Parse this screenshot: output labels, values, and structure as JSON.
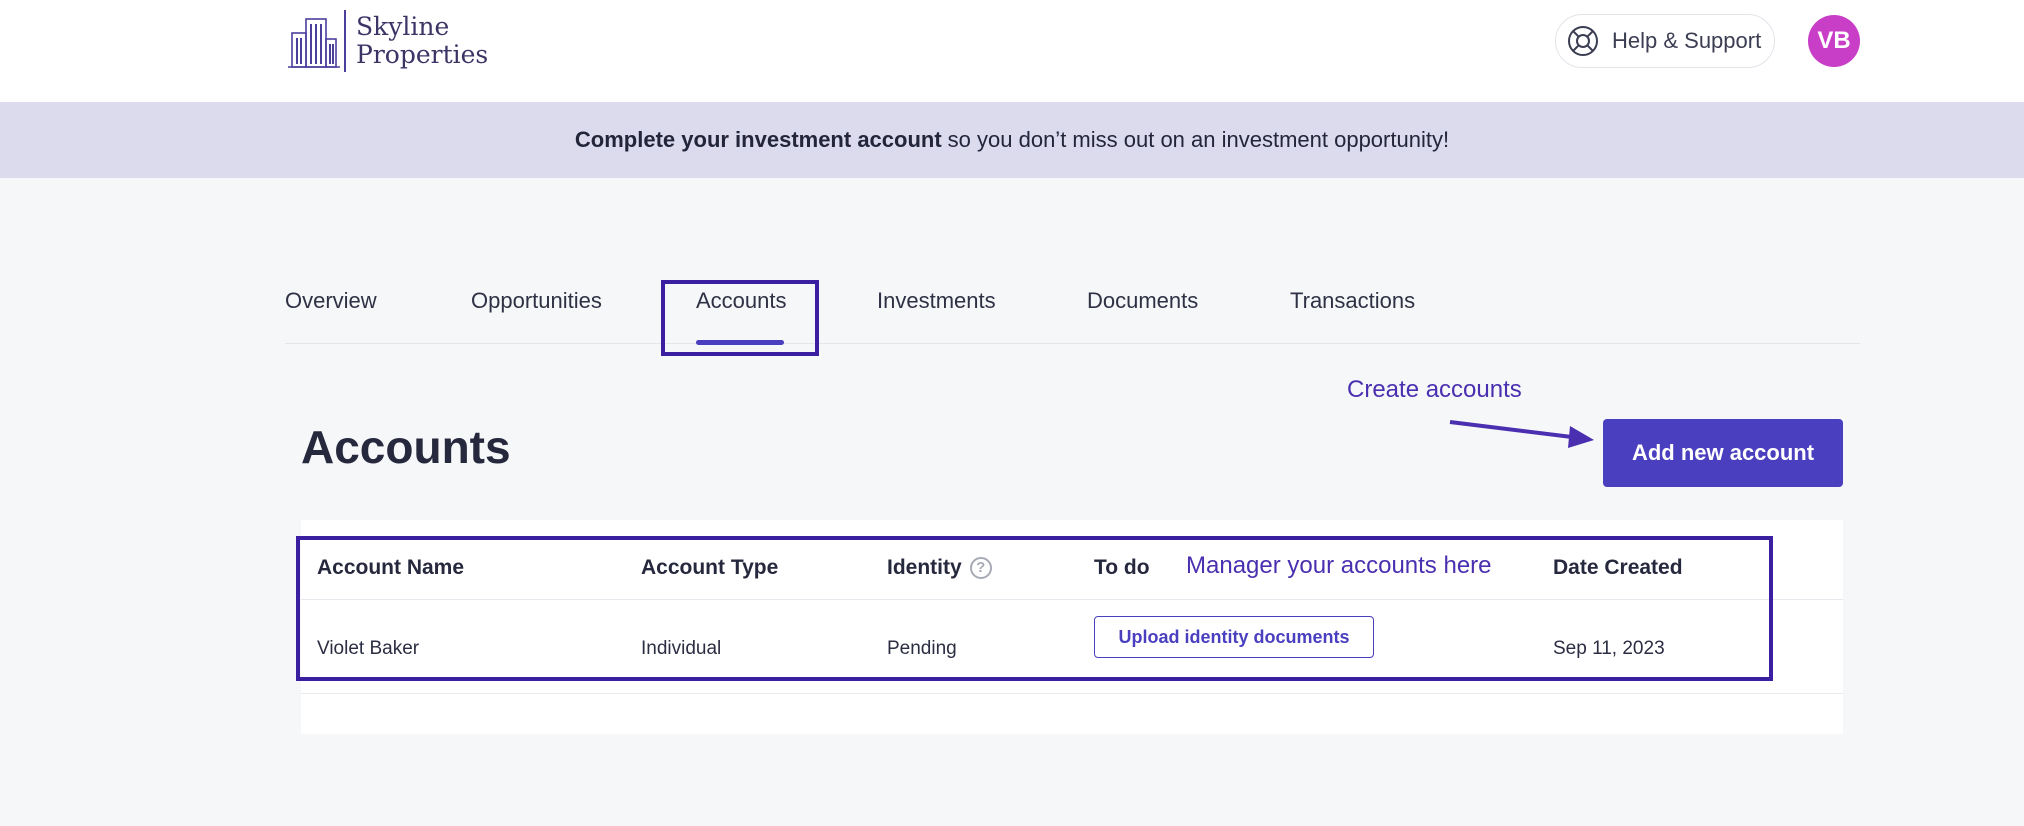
{
  "header": {
    "brand_line1": "Skyline",
    "brand_line2": "Properties",
    "help_label": "Help & Support",
    "avatar_initials": "VB"
  },
  "banner": {
    "bold_text": "Complete your investment account",
    "rest_text": "so you don’t miss out on an investment opportunity!"
  },
  "tabs": [
    {
      "label": "Overview"
    },
    {
      "label": "Opportunities"
    },
    {
      "label": "Accounts",
      "active": true
    },
    {
      "label": "Investments"
    },
    {
      "label": "Documents"
    },
    {
      "label": "Transactions"
    }
  ],
  "page": {
    "title": "Accounts",
    "add_button": "Add new account"
  },
  "annotations": {
    "create": "Create accounts",
    "manage": "Manager your accounts here"
  },
  "table": {
    "columns": [
      "Account Name",
      "Account Type",
      "Identity",
      "To do",
      "Date Created"
    ],
    "rows": [
      {
        "account_name": "Violet Baker",
        "account_type": "Individual",
        "identity": "Pending",
        "todo_action": "Upload identity documents",
        "date_created": "Sep 11, 2023"
      }
    ]
  },
  "colors": {
    "accent": "#4a3fbf",
    "banner_bg": "#dcdbee",
    "annotation": "#3a1fa0",
    "avatar": "#c93ec6"
  }
}
